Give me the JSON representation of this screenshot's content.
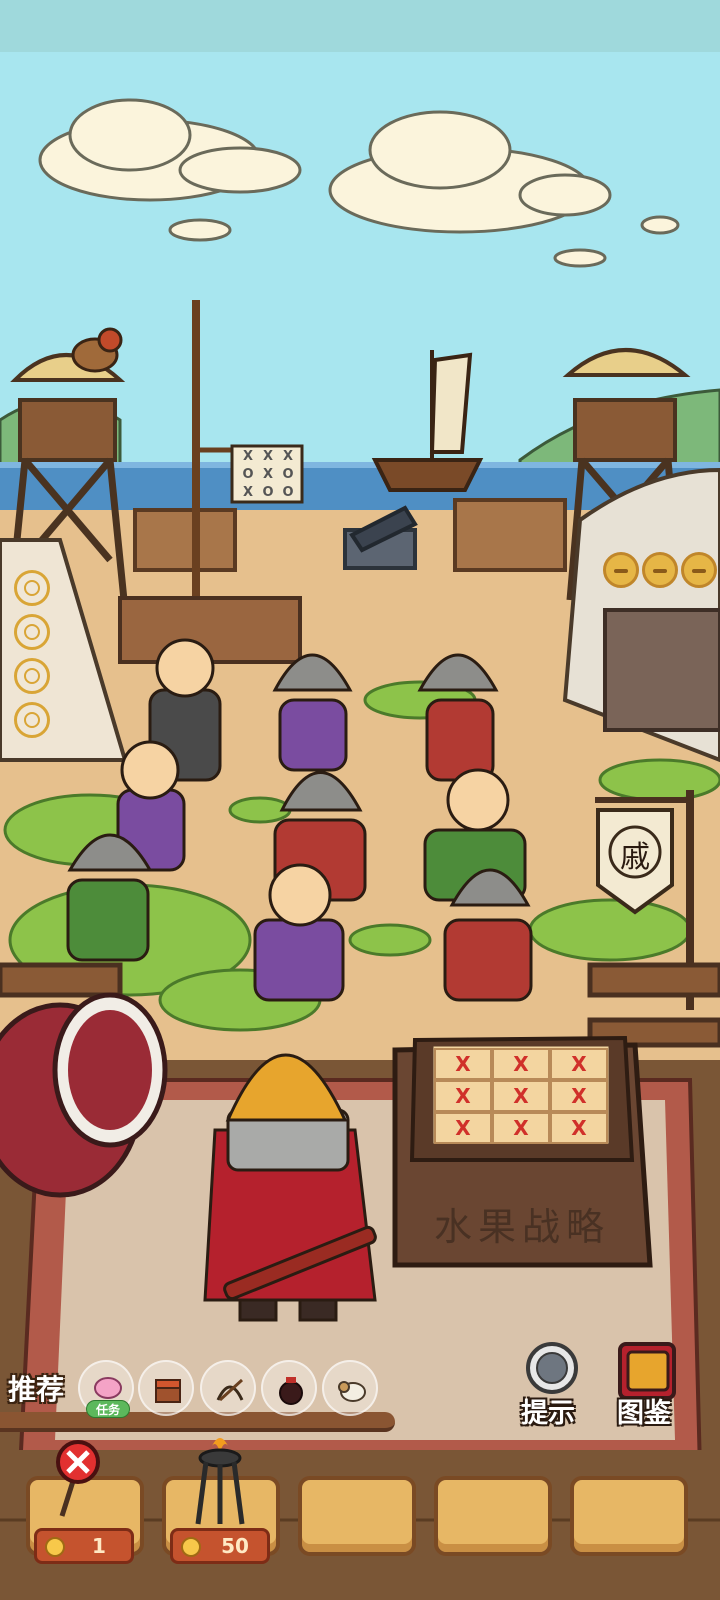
{
  "scene": {
    "board_title": "水果战略",
    "banner_glyph": "戚",
    "flag_marks": [
      "X",
      "X",
      "X",
      "O",
      "X",
      "O",
      "X",
      "O",
      "O"
    ],
    "board_marks": [
      "X",
      "X",
      "X",
      "X",
      "X",
      "X",
      "X",
      "X",
      "X"
    ]
  },
  "recommend": {
    "label": "推荐",
    "task_badge": "任务",
    "items": [
      {
        "name": "brain-icon"
      },
      {
        "name": "treasure-chest-icon"
      },
      {
        "name": "crossbow-icon"
      },
      {
        "name": "wine-jar-icon"
      },
      {
        "name": "ram-icon"
      }
    ]
  },
  "buttons": {
    "hint_label": "提示",
    "codex_label": "图鉴"
  },
  "slots": {
    "costs": [
      "1",
      "50"
    ]
  },
  "colors": {
    "sky": "#a8e6ef",
    "sand": "#e6c08d",
    "grass": "#8dc34a",
    "cost_tag": "#c5532e"
  }
}
